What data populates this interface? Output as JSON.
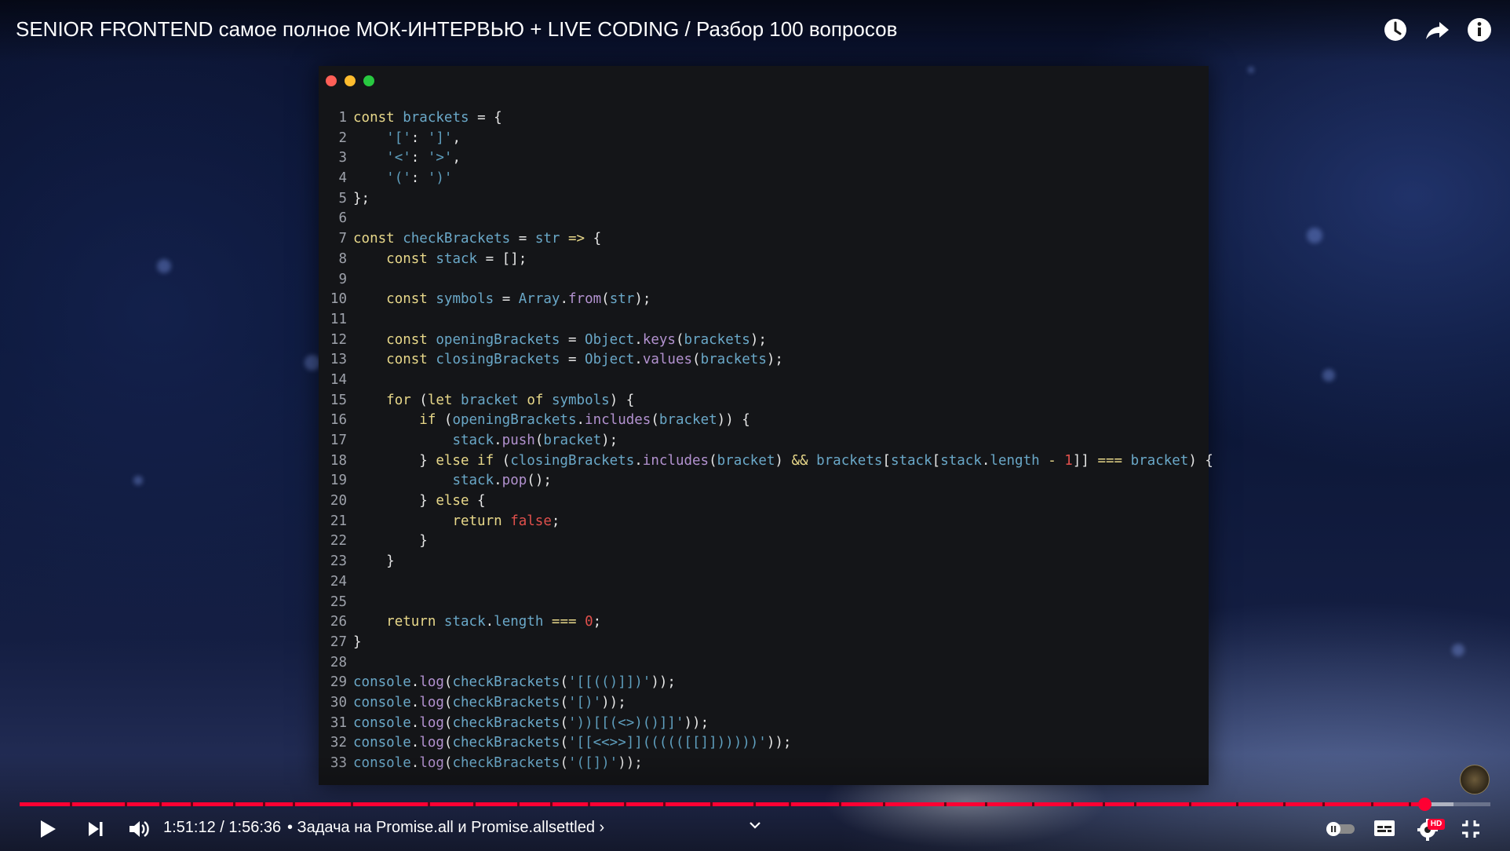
{
  "video": {
    "title": "SENIOR FRONTEND самое полное МОК-ИНТЕРВЬЮ + LIVE CODING / Разбор 100 вопросов"
  },
  "top_controls": {
    "icons": [
      "watch-later-icon",
      "share-icon",
      "info-icon"
    ]
  },
  "code_window": {
    "traffic_lights": [
      "#ff5f57",
      "#febc2e",
      "#28c840"
    ],
    "lines": [
      {
        "n": "1",
        "tokens": [
          [
            "kw",
            "const"
          ],
          [
            "t",
            " "
          ],
          [
            "var",
            "brackets"
          ],
          [
            "t",
            " = {"
          ]
        ]
      },
      {
        "n": "2",
        "tokens": [
          [
            "t",
            "    "
          ],
          [
            "str",
            "'['"
          ],
          [
            "t",
            ": "
          ],
          [
            "str",
            "']'"
          ],
          [
            "t",
            ","
          ]
        ]
      },
      {
        "n": "3",
        "tokens": [
          [
            "t",
            "    "
          ],
          [
            "str",
            "'<'"
          ],
          [
            "t",
            ": "
          ],
          [
            "str",
            "'>'"
          ],
          [
            "t",
            ","
          ]
        ]
      },
      {
        "n": "4",
        "tokens": [
          [
            "t",
            "    "
          ],
          [
            "str",
            "'('"
          ],
          [
            "t",
            ": "
          ],
          [
            "str",
            "')'"
          ]
        ]
      },
      {
        "n": "5",
        "tokens": [
          [
            "t",
            "};"
          ]
        ]
      },
      {
        "n": "6",
        "tokens": []
      },
      {
        "n": "7",
        "tokens": [
          [
            "kw",
            "const"
          ],
          [
            "t",
            " "
          ],
          [
            "var",
            "checkBrackets"
          ],
          [
            "t",
            " = "
          ],
          [
            "var",
            "str"
          ],
          [
            "t",
            " "
          ],
          [
            "op",
            "=>"
          ],
          [
            "t",
            " {"
          ]
        ]
      },
      {
        "n": "8",
        "tokens": [
          [
            "t",
            "    "
          ],
          [
            "kw",
            "const"
          ],
          [
            "t",
            " "
          ],
          [
            "var",
            "stack"
          ],
          [
            "t",
            " = [];"
          ]
        ]
      },
      {
        "n": "9",
        "tokens": []
      },
      {
        "n": "10",
        "tokens": [
          [
            "t",
            "    "
          ],
          [
            "kw",
            "const"
          ],
          [
            "t",
            " "
          ],
          [
            "var",
            "symbols"
          ],
          [
            "t",
            " = "
          ],
          [
            "var",
            "Array"
          ],
          [
            "t",
            "."
          ],
          [
            "fn",
            "from"
          ],
          [
            "t",
            "("
          ],
          [
            "var",
            "str"
          ],
          [
            "t",
            ");"
          ]
        ]
      },
      {
        "n": "11",
        "tokens": []
      },
      {
        "n": "12",
        "tokens": [
          [
            "t",
            "    "
          ],
          [
            "kw",
            "const"
          ],
          [
            "t",
            " "
          ],
          [
            "var",
            "openingBrackets"
          ],
          [
            "t",
            " = "
          ],
          [
            "var",
            "Object"
          ],
          [
            "t",
            "."
          ],
          [
            "fn",
            "keys"
          ],
          [
            "t",
            "("
          ],
          [
            "var",
            "brackets"
          ],
          [
            "t",
            ");"
          ]
        ]
      },
      {
        "n": "13",
        "tokens": [
          [
            "t",
            "    "
          ],
          [
            "kw",
            "const"
          ],
          [
            "t",
            " "
          ],
          [
            "var",
            "closingBrackets"
          ],
          [
            "t",
            " = "
          ],
          [
            "var",
            "Object"
          ],
          [
            "t",
            "."
          ],
          [
            "fn",
            "values"
          ],
          [
            "t",
            "("
          ],
          [
            "var",
            "brackets"
          ],
          [
            "t",
            ");"
          ]
        ]
      },
      {
        "n": "14",
        "tokens": []
      },
      {
        "n": "15",
        "tokens": [
          [
            "t",
            "    "
          ],
          [
            "kw",
            "for"
          ],
          [
            "t",
            " ("
          ],
          [
            "kw",
            "let"
          ],
          [
            "t",
            " "
          ],
          [
            "var",
            "bracket"
          ],
          [
            "t",
            " "
          ],
          [
            "kw",
            "of"
          ],
          [
            "t",
            " "
          ],
          [
            "var",
            "symbols"
          ],
          [
            "t",
            ") {"
          ]
        ]
      },
      {
        "n": "16",
        "tokens": [
          [
            "t",
            "        "
          ],
          [
            "kw",
            "if"
          ],
          [
            "t",
            " ("
          ],
          [
            "var",
            "openingBrackets"
          ],
          [
            "t",
            "."
          ],
          [
            "fn",
            "includes"
          ],
          [
            "t",
            "("
          ],
          [
            "var",
            "bracket"
          ],
          [
            "t",
            ")) {"
          ]
        ]
      },
      {
        "n": "17",
        "tokens": [
          [
            "t",
            "            "
          ],
          [
            "var",
            "stack"
          ],
          [
            "t",
            "."
          ],
          [
            "fn",
            "push"
          ],
          [
            "t",
            "("
          ],
          [
            "var",
            "bracket"
          ],
          [
            "t",
            ");"
          ]
        ]
      },
      {
        "n": "18",
        "tokens": [
          [
            "t",
            "        } "
          ],
          [
            "kw",
            "else if"
          ],
          [
            "t",
            " ("
          ],
          [
            "var",
            "closingBrackets"
          ],
          [
            "t",
            "."
          ],
          [
            "fn",
            "includes"
          ],
          [
            "t",
            "("
          ],
          [
            "var",
            "bracket"
          ],
          [
            "t",
            ") "
          ],
          [
            "op",
            "&&"
          ],
          [
            "t",
            " "
          ],
          [
            "var",
            "brackets"
          ],
          [
            "t",
            "["
          ],
          [
            "var",
            "stack"
          ],
          [
            "t",
            "["
          ],
          [
            "var",
            "stack"
          ],
          [
            "t",
            "."
          ],
          [
            "var",
            "length"
          ],
          [
            "t",
            " "
          ],
          [
            "op",
            "-"
          ],
          [
            "t",
            " "
          ],
          [
            "num",
            "1"
          ],
          [
            "t",
            "]] "
          ],
          [
            "op",
            "==="
          ],
          [
            "t",
            " "
          ],
          [
            "var",
            "bracket"
          ],
          [
            "t",
            ") {"
          ]
        ]
      },
      {
        "n": "19",
        "tokens": [
          [
            "t",
            "            "
          ],
          [
            "var",
            "stack"
          ],
          [
            "t",
            "."
          ],
          [
            "fn",
            "pop"
          ],
          [
            "t",
            "();"
          ]
        ]
      },
      {
        "n": "20",
        "tokens": [
          [
            "t",
            "        } "
          ],
          [
            "kw",
            "else"
          ],
          [
            "t",
            " {"
          ]
        ]
      },
      {
        "n": "21",
        "tokens": [
          [
            "t",
            "            "
          ],
          [
            "kw",
            "return"
          ],
          [
            "t",
            " "
          ],
          [
            "bool",
            "false"
          ],
          [
            "t",
            ";"
          ]
        ]
      },
      {
        "n": "22",
        "tokens": [
          [
            "t",
            "        }"
          ]
        ]
      },
      {
        "n": "23",
        "tokens": [
          [
            "t",
            "    }"
          ]
        ]
      },
      {
        "n": "24",
        "tokens": []
      },
      {
        "n": "25",
        "tokens": []
      },
      {
        "n": "26",
        "tokens": [
          [
            "t",
            "    "
          ],
          [
            "kw",
            "return"
          ],
          [
            "t",
            " "
          ],
          [
            "var",
            "stack"
          ],
          [
            "t",
            "."
          ],
          [
            "var",
            "length"
          ],
          [
            "t",
            " "
          ],
          [
            "op",
            "==="
          ],
          [
            "t",
            " "
          ],
          [
            "num",
            "0"
          ],
          [
            "t",
            ";"
          ]
        ]
      },
      {
        "n": "27",
        "tokens": [
          [
            "t",
            "}"
          ]
        ]
      },
      {
        "n": "28",
        "tokens": []
      },
      {
        "n": "29",
        "tokens": [
          [
            "var",
            "console"
          ],
          [
            "t",
            "."
          ],
          [
            "fn",
            "log"
          ],
          [
            "t",
            "("
          ],
          [
            "var",
            "checkBrackets"
          ],
          [
            "t",
            "("
          ],
          [
            "str",
            "'[[(()]])'"
          ],
          [
            "t",
            "));"
          ]
        ]
      },
      {
        "n": "30",
        "tokens": [
          [
            "var",
            "console"
          ],
          [
            "t",
            "."
          ],
          [
            "fn",
            "log"
          ],
          [
            "t",
            "("
          ],
          [
            "var",
            "checkBrackets"
          ],
          [
            "t",
            "("
          ],
          [
            "str",
            "'[)'"
          ],
          [
            "t",
            "));"
          ]
        ]
      },
      {
        "n": "31",
        "tokens": [
          [
            "var",
            "console"
          ],
          [
            "t",
            "."
          ],
          [
            "fn",
            "log"
          ],
          [
            "t",
            "("
          ],
          [
            "var",
            "checkBrackets"
          ],
          [
            "t",
            "("
          ],
          [
            "str",
            "'))[[(<>)()]]'"
          ],
          [
            "t",
            "));"
          ]
        ]
      },
      {
        "n": "32",
        "tokens": [
          [
            "var",
            "console"
          ],
          [
            "t",
            "."
          ],
          [
            "fn",
            "log"
          ],
          [
            "t",
            "("
          ],
          [
            "var",
            "checkBrackets"
          ],
          [
            "t",
            "("
          ],
          [
            "str",
            "'[[<<>>]]((((([[]])))))'"
          ],
          [
            "t",
            "));"
          ]
        ]
      },
      {
        "n": "33",
        "tokens": [
          [
            "var",
            "console"
          ],
          [
            "t",
            "."
          ],
          [
            "fn",
            "log"
          ],
          [
            "t",
            "("
          ],
          [
            "var",
            "checkBrackets"
          ],
          [
            "t",
            "("
          ],
          [
            "str",
            "'([])'"
          ],
          [
            "t",
            "));"
          ]
        ]
      }
    ]
  },
  "player": {
    "progress_played": 0.9553,
    "progress_buffered": 0.975,
    "time_display": "1:51:12 / 1:56:36",
    "chapter_label": "• Задача на Promise.all и Promise.allsettled ›",
    "accent_color": "#ff0033",
    "hd_badge": "HD",
    "controls": [
      "play-icon",
      "next-icon",
      "volume-icon",
      "autoplay-toggle-icon",
      "subtitles-icon",
      "settings-icon",
      "exit-fullscreen-icon"
    ]
  }
}
